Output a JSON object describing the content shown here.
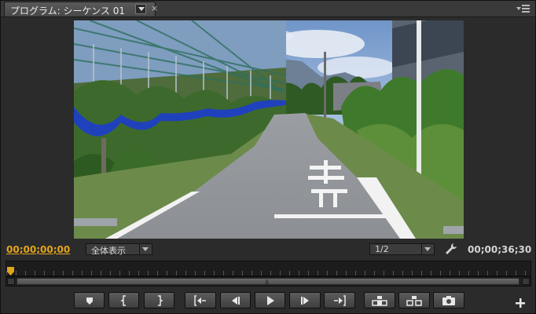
{
  "panel": {
    "tab_title": "プログラム: シーケンス 01",
    "tab_menu_icon": "chevron-down-icon",
    "close_label": "×",
    "panel_menu_icon": "panel-menu-icon"
  },
  "monitor": {
    "current_timecode": "00;00;00;00",
    "zoom_select": "全体表示",
    "resolution_select": "1/2",
    "settings_icon": "wrench-icon",
    "duration_timecode": "00;00;36;30",
    "playhead_position": 0
  },
  "transport": {
    "buttons": [
      {
        "name": "add-marker-button",
        "icon": "marker-icon"
      },
      {
        "name": "mark-in-button",
        "icon": "mark-in-icon"
      },
      {
        "name": "mark-out-button",
        "icon": "mark-out-icon"
      },
      {
        "name": "go-to-in-button",
        "icon": "go-to-in-icon"
      },
      {
        "name": "step-back-button",
        "icon": "step-back-icon"
      },
      {
        "name": "play-button",
        "icon": "play-icon"
      },
      {
        "name": "step-forward-button",
        "icon": "step-forward-icon"
      },
      {
        "name": "go-to-out-button",
        "icon": "go-to-out-icon"
      },
      {
        "name": "lift-button",
        "icon": "lift-icon"
      },
      {
        "name": "extract-button",
        "icon": "extract-icon"
      },
      {
        "name": "export-frame-button",
        "icon": "camera-icon"
      }
    ],
    "add_button_icon": "plus-icon"
  },
  "colors": {
    "accent_timecode": "#e2a51c",
    "panel_bg": "#2b2b2b",
    "button_face": "#4d4d4d"
  }
}
